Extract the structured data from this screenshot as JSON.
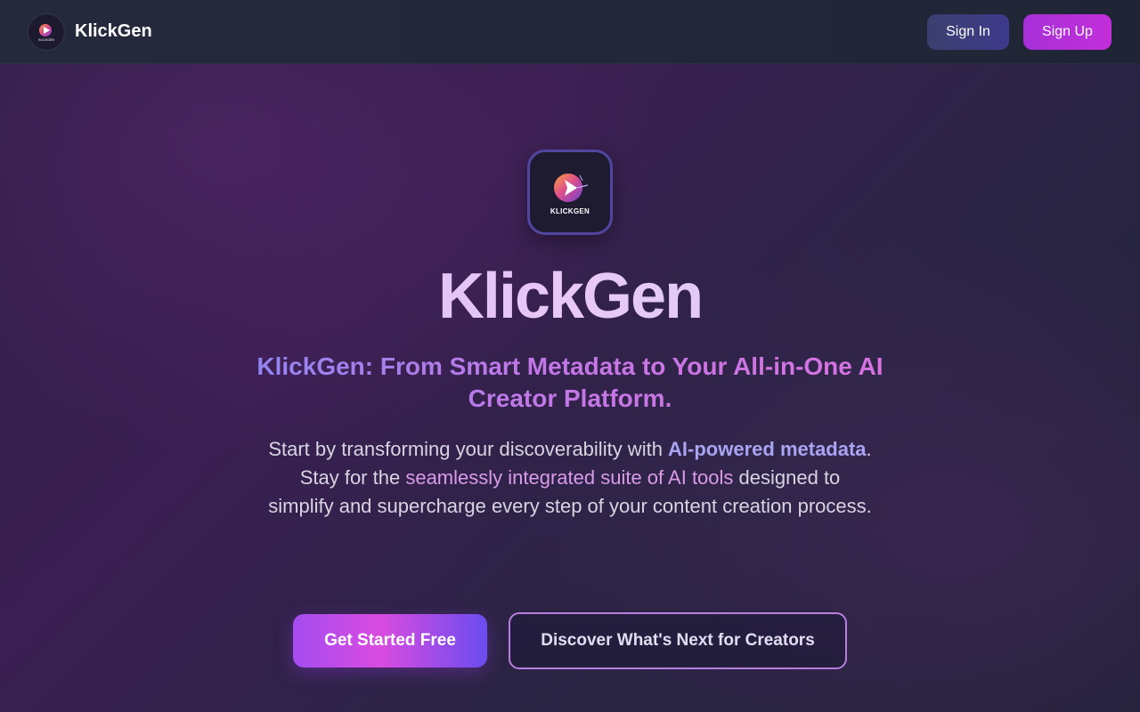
{
  "header": {
    "brand_name": "KlickGen",
    "sign_in_label": "Sign In",
    "sign_up_label": "Sign Up"
  },
  "hero": {
    "logo_text": "KLICKGEN",
    "title": "KlickGen",
    "subtitle": "KlickGen: From Smart Metadata to Your All-in-One AI Creator Platform.",
    "description": {
      "part1": "Start by transforming your discoverability with ",
      "highlight1": "AI-powered metadata",
      "part2": ". Stay for the ",
      "highlight2": "seamlessly integrated suite of AI tools",
      "part3": " designed to simplify and supercharge every step of your content creation process."
    },
    "primary_cta": "Get Started Free",
    "secondary_cta": "Discover What's Next for Creators"
  },
  "colors": {
    "accent_purple": "#a72fd8",
    "accent_indigo": "#3e3a8c",
    "highlight_blue": "#a9a4f2",
    "highlight_pink": "#d99be8"
  },
  "icons": {
    "brand": "play-orb-icon"
  }
}
